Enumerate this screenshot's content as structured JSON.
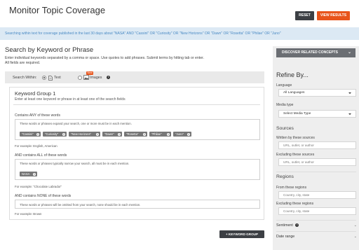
{
  "header": {
    "title": "Monitor Topic Coverage",
    "reset_label": "RESET",
    "view_results_label": "VIEW RESULTS"
  },
  "info_bar": {
    "text": "Searching within text for coverage published in the last 30 days about \"NASA\" AND \"Cassini\" OR \"Curiosity\" OR \"New Horizons\" OR \"Dawn\" OR \"Rosetta\" OR \"Philae\" OR \"Juno\""
  },
  "search": {
    "title": "Search by Keyword or Phrase",
    "desc_line1": "Enter individual keywords separated by a comma or space. Use quotes to add phrases. Submit terms by hitting tab or enter.",
    "desc_line2": "All fields are required.",
    "within_label": "Search Within:",
    "option_text": "Text",
    "option_images": "Images",
    "new_badge": "New"
  },
  "keyword_group": {
    "title": "Keyword Group 1",
    "subtitle": "Enter at least one keyword or phrase in at least one of the search fields",
    "any": {
      "label": "Contains ANY of these words",
      "hint": "These words or phrases expand your search, one or more must be in each mention.",
      "tags": [
        "\"Cassini\"",
        "\"Curiosity\"",
        "\"New Horizons\"",
        "\"Dawn\"",
        "\"Rosetta\"",
        "\"Philae\"",
        "\"Juno\""
      ],
      "example": "For example: English, American"
    },
    "all": {
      "label": "AND contains ALL of these words",
      "hint": "These words or phrases typically narrow your search, all must be in each mention.",
      "tags": [
        "NASA"
      ],
      "example": "For example: \"Chocolate Labrador\""
    },
    "none": {
      "label": "AND contains NONE of these words",
      "hint": "These words or phrases will be omitted from your search, none should be in each mention.",
      "example": "For example: Brown"
    },
    "add_button": "+ KEYWORD GROUP"
  },
  "sidebar": {
    "discover_button": "DISCOVER RELATED CONCEPTS",
    "refine_title": "Refine By...",
    "language_label": "Language",
    "language_value": "All Languages",
    "media_label": "Media type",
    "media_value": "Select Media Type",
    "sources_heading": "Sources",
    "written_by_label": "Written by these sources",
    "written_by_placeholder": "URL, outlet, or author",
    "excluding_sources_label": "Excluding these sources",
    "excluding_sources_placeholder": "URL, outlet, or author",
    "regions_heading": "Regions",
    "from_regions_label": "From these regions",
    "from_regions_placeholder": "Country, city, state",
    "excluding_regions_label": "Excluding these regions",
    "excluding_regions_placeholder": "Country, city, state",
    "sentiment_label": "Sentiment",
    "date_range_label": "Date range"
  },
  "colors": {
    "accent": "#e8541b",
    "dark_button": "#3c3f44",
    "info_bar_bg": "#dce9f4",
    "info_bar_text": "#4a8ac4"
  }
}
